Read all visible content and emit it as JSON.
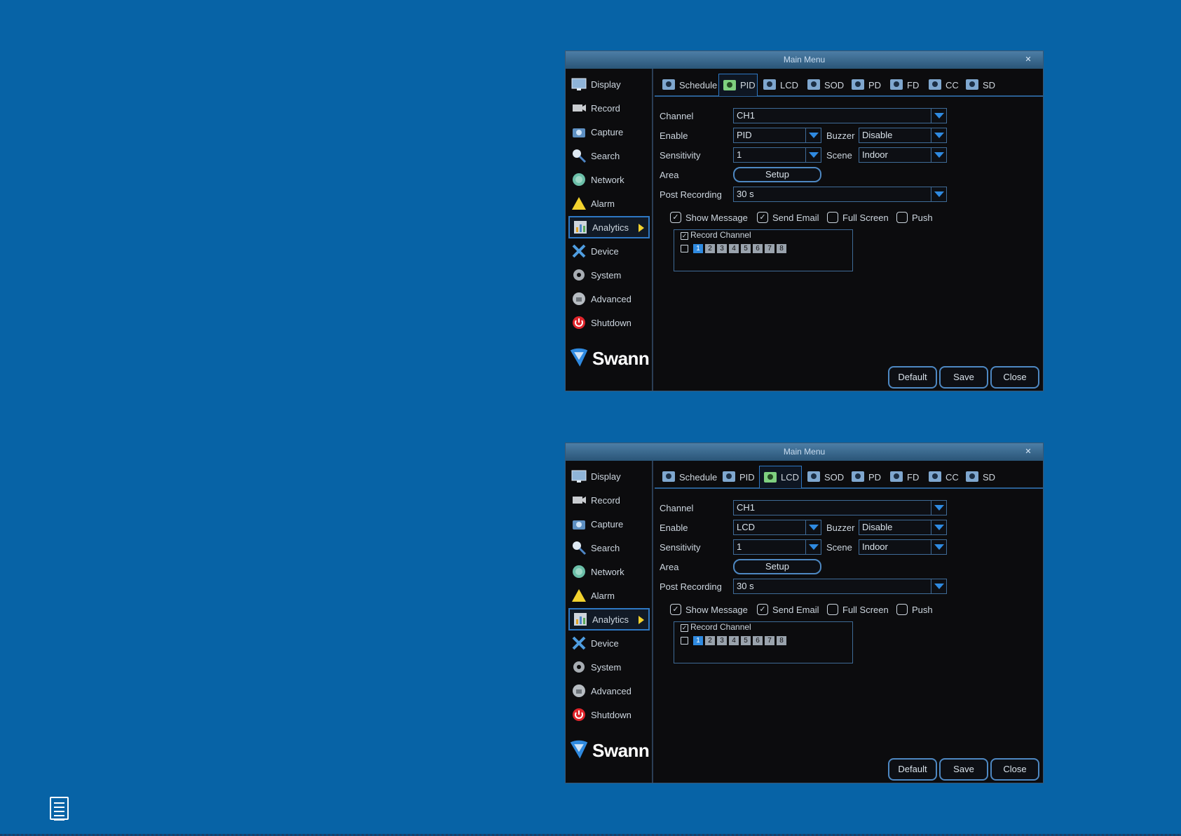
{
  "screens": [
    {
      "title": "Main Menu",
      "active_tab": 1,
      "enable_value": "PID",
      "active_nav": 6
    },
    {
      "title": "Main Menu",
      "active_tab": 2,
      "enable_value": "LCD",
      "active_nav": 6
    }
  ],
  "window": {
    "close_glyph": "✕",
    "brand": "Swann"
  },
  "sidebar": {
    "items": [
      {
        "label": "Display",
        "icon": "display-icon"
      },
      {
        "label": "Record",
        "icon": "record-icon"
      },
      {
        "label": "Capture",
        "icon": "capture-icon"
      },
      {
        "label": "Search",
        "icon": "search-icon"
      },
      {
        "label": "Network",
        "icon": "network-icon"
      },
      {
        "label": "Alarm",
        "icon": "alarm-icon"
      },
      {
        "label": "Analytics",
        "icon": "analytics-icon"
      },
      {
        "label": "Device",
        "icon": "device-icon"
      },
      {
        "label": "System",
        "icon": "system-icon"
      },
      {
        "label": "Advanced",
        "icon": "advanced-icon"
      },
      {
        "label": "Shutdown",
        "icon": "shutdown-icon"
      }
    ]
  },
  "tabs": [
    {
      "label": "Schedule"
    },
    {
      "label": "PID"
    },
    {
      "label": "LCD"
    },
    {
      "label": "SOD"
    },
    {
      "label": "PD"
    },
    {
      "label": "FD"
    },
    {
      "label": "CC"
    },
    {
      "label": "SD"
    }
  ],
  "form": {
    "channel_label": "Channel",
    "channel_value": "CH1",
    "enable_label": "Enable",
    "buzzer_label": "Buzzer",
    "buzzer_value": "Disable",
    "sensitivity_label": "Sensitivity",
    "sensitivity_value": "1",
    "scene_label": "Scene",
    "scene_value": "Indoor",
    "area_label": "Area",
    "setup_label": "Setup",
    "post_recording_label": "Post Recording",
    "post_recording_value": "30 s",
    "show_message_label": "Show Message",
    "show_message_checked": true,
    "send_email_label": "Send Email",
    "send_email_checked": true,
    "full_screen_label": "Full Screen",
    "full_screen_checked": false,
    "push_label": "Push",
    "push_checked": false,
    "record_channel_label": "Record Channel",
    "record_channel_checked": true,
    "all_channels_checked": false,
    "channels": [
      "1",
      "2",
      "3",
      "4",
      "5",
      "6",
      "7",
      "8"
    ],
    "selected_channel": 0
  },
  "footer": {
    "default_label": "Default",
    "save_label": "Save",
    "close_label": "Close"
  },
  "colors": {
    "background": "#0763a6",
    "accent": "#2f8ae0",
    "alarm": "#f2d22e",
    "shutdown": "#e0252c"
  }
}
